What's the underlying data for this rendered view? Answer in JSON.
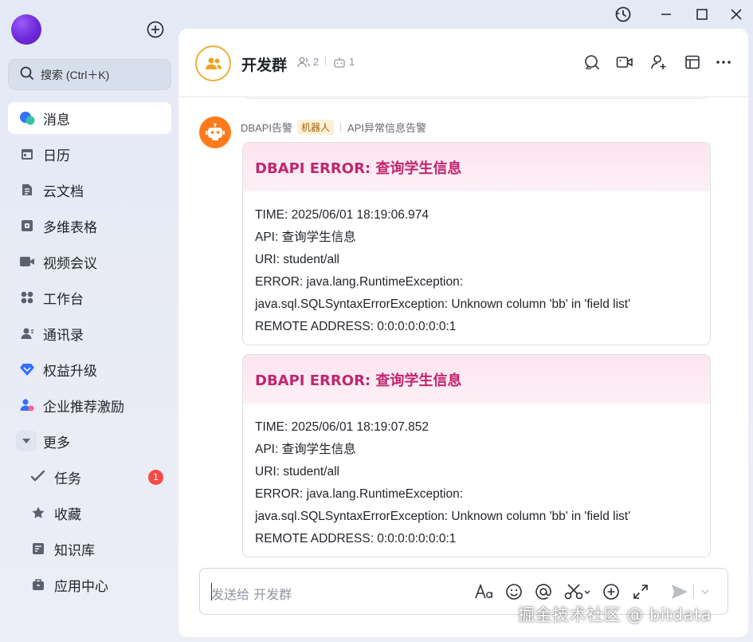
{
  "sidebar": {
    "search_placeholder": "搜索 (Ctrl＋K)",
    "items": [
      {
        "label": "消息",
        "icon": "message-icon",
        "active": true
      },
      {
        "label": "日历",
        "icon": "calendar-icon"
      },
      {
        "label": "云文档",
        "icon": "cloud-doc-icon"
      },
      {
        "label": "多维表格",
        "icon": "bitable-icon"
      },
      {
        "label": "视频会议",
        "icon": "video-meeting-icon"
      },
      {
        "label": "工作台",
        "icon": "workplace-icon"
      },
      {
        "label": "通讯录",
        "icon": "contacts-icon"
      },
      {
        "label": "权益升级",
        "icon": "diamond-icon"
      },
      {
        "label": "企业推荐激励",
        "icon": "referral-icon"
      },
      {
        "label": "更多",
        "icon": "chevron-down-icon"
      }
    ],
    "sub_items": [
      {
        "label": "任务",
        "icon": "task-icon",
        "badge": "1"
      },
      {
        "label": "收藏",
        "icon": "star-icon"
      },
      {
        "label": "知识库",
        "icon": "wiki-icon"
      },
      {
        "label": "应用中心",
        "icon": "app-center-icon"
      }
    ]
  },
  "chat": {
    "title": "开发群",
    "member_count": "2",
    "bot_count": "1",
    "sender": {
      "name": "DBAPI告警",
      "tag": "机器人",
      "source": "API异常信息告警"
    },
    "messages": [
      {
        "title": "DBAPI ERROR: 查询学生信息",
        "lines": [
          "TIME: 2025/06/01 18:19:06.974",
          "API: 查询学生信息",
          "URI: student/all",
          "ERROR: java.lang.RuntimeException:",
          "java.sql.SQLSyntaxErrorException: Unknown column 'bb' in 'field list'",
          "REMOTE ADDRESS: 0:0:0:0:0:0:0:1"
        ]
      },
      {
        "title": "DBAPI ERROR: 查询学生信息",
        "lines": [
          "TIME: 2025/06/01 18:19:07.852",
          "API: 查询学生信息",
          "URI: student/all",
          "ERROR: java.lang.RuntimeException:",
          "java.sql.SQLSyntaxErrorException: Unknown column 'bb' in 'field list'",
          "REMOTE ADDRESS: 0:0:0:0:0:0:0:1"
        ]
      }
    ],
    "input_placeholder": "发送给 开发群"
  },
  "watermark": "掘金技术社区 @ bitdata",
  "colors": {
    "accent": "#3370ff",
    "card_title": "#c0266f",
    "badge": "#f54a45",
    "bot_avatar": "#ff7a1a",
    "group_ring": "#e8b23f"
  }
}
